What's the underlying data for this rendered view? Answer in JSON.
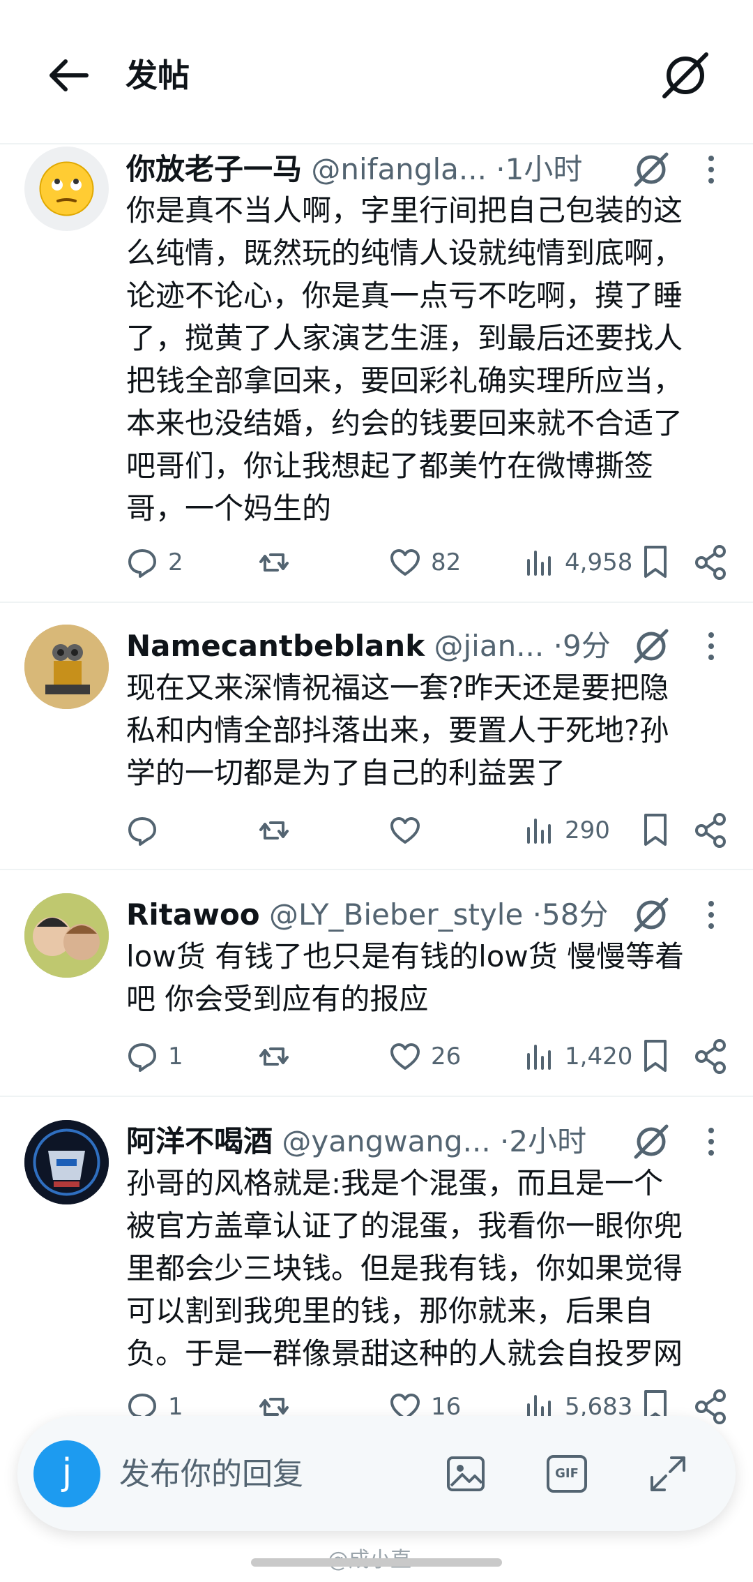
{
  "header": {
    "title": "发帖",
    "back_icon": "arrow-left-icon",
    "grok_icon": "grok-icon"
  },
  "posts": [
    {
      "author": "你放老子一马",
      "handle": "@nifangla...",
      "time": "1小时",
      "text": "你是真不当人啊，字里行间把自己包装的这\n么纯情，既然玩的纯情人设就纯情到底啊，\n论迹不论心，你是真一点亏不吃啊，摸了睡\n了，搅黄了人家演艺生涯，到最后还要找人\n把钱全部拿回来，要回彩礼确实理所应当，\n本来也没结婚，约会的钱要回来就不合适了\n吧哥们，你让我想起了都美竹在微博撕签\n哥，一个妈生的",
      "replies": "2",
      "reposts": "",
      "likes": "82",
      "views": "4,958",
      "avatar": "rolling-eyes-emoji"
    },
    {
      "author": "Namecantbeblank",
      "handle": "@jian...",
      "time": "9分",
      "text": "现在又来深情祝福这一套?昨天还是要把隐\n私和内情全部抖落出来，要置人于死地?孙\n学的一切都是为了自己的利益罢了",
      "replies": "",
      "reposts": "",
      "likes": "",
      "views": "290",
      "avatar": "robot-photo"
    },
    {
      "author": "Ritawoo",
      "handle": "@LY_Bieber_style",
      "time": "58分",
      "text": "low货 有钱了也只是有钱的low货 慢慢等着\n吧 你会受到应有的报应",
      "replies": "1",
      "reposts": "",
      "likes": "26",
      "views": "1,420",
      "avatar": "two-kids-photo"
    },
    {
      "author": "阿洋不喝酒",
      "handle": "@yangwang...",
      "time": "2小时",
      "text": "孙哥的风格就是:我是个混蛋，而且是一个\n被官方盖章认证了的混蛋，我看你一眼你兜\n里都会少三块钱。但是我有钱，你如果觉得\n可以割到我兜里的钱，那你就来，后果自\n负。于是一群像景甜这种的人就会自投罗网",
      "replies": "1",
      "reposts": "",
      "likes": "16",
      "views": "5,683",
      "avatar": "soundwave-badge"
    }
  ],
  "post_separator_dot": "·",
  "reply_bar": {
    "avatar_letter": "j",
    "placeholder": "发布你的回复",
    "icons": [
      "image-icon",
      "gif-icon",
      "expand-icon"
    ],
    "gif_label": "GIF"
  },
  "watermark": "@成小直",
  "colors": {
    "accent": "#1d9bf0",
    "muted": "#536471",
    "text": "#0f1419",
    "divider": "#eff3f4"
  }
}
